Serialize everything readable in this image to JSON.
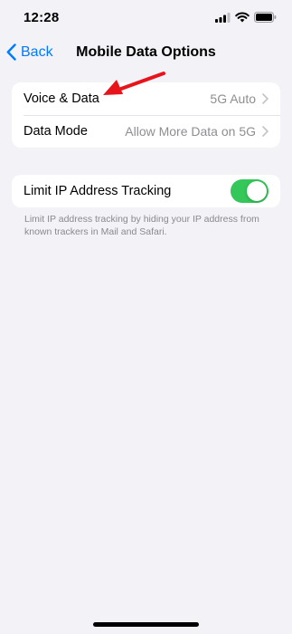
{
  "status_bar": {
    "time": "12:28",
    "icons": [
      "cellular-signal-icon",
      "wifi-icon",
      "battery-icon"
    ]
  },
  "nav": {
    "back_label": "Back",
    "title": "Mobile Data Options"
  },
  "cellular_group": {
    "rows": [
      {
        "label": "Voice & Data",
        "value": "5G Auto"
      },
      {
        "label": "Data Mode",
        "value": "Allow More Data on 5G"
      }
    ]
  },
  "privacy_group": {
    "label": "Limit IP Address Tracking",
    "toggle_on": true,
    "footer": "Limit IP address tracking by hiding your IP address from known trackers in Mail and Safari."
  },
  "colors": {
    "accent": "#007aff",
    "toggle_on": "#34c759",
    "annotation_arrow": "#e8141c",
    "background": "#f2f2f7"
  }
}
